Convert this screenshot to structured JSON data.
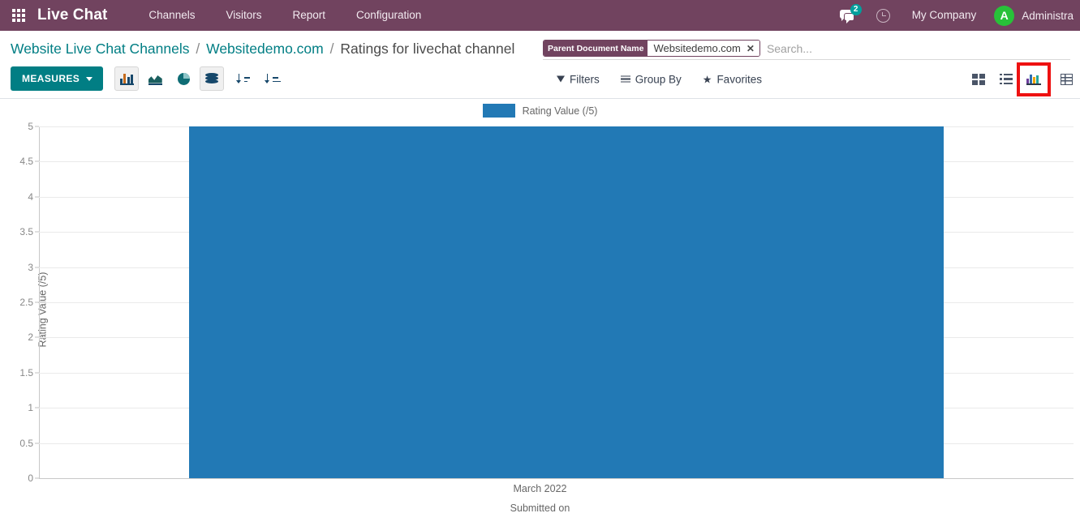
{
  "navbar": {
    "apps_icon": "grid-apps-icon",
    "brand": "Live Chat",
    "menu": [
      {
        "label": "Channels"
      },
      {
        "label": "Visitors"
      },
      {
        "label": "Report"
      },
      {
        "label": "Configuration"
      }
    ],
    "messages_icon": "messages-icon",
    "messages_badge": "2",
    "activity_icon": "clock-icon",
    "company": "My Company",
    "avatar_initial": "A",
    "username": "Administra",
    "background_color": "#71435f"
  },
  "breadcrumb": {
    "root": "Website Live Chat Channels",
    "parent": "Websitedemo.com",
    "current": "Ratings for livechat channel",
    "separator": "/"
  },
  "search": {
    "facet_label": "Parent Document Name",
    "facet_value": "Websitedemo.com",
    "facet_remove_icon": "close-icon",
    "placeholder": "Search...",
    "value": ""
  },
  "toolbar": {
    "measures_label": "MEASURES",
    "measures_color": "#017e84",
    "buttons": [
      {
        "name": "bar-chart",
        "icon": "bar-chart-icon",
        "active": true
      },
      {
        "name": "line-chart",
        "icon": "line-chart-icon",
        "active": false
      },
      {
        "name": "pie-chart",
        "icon": "pie-chart-icon",
        "active": false
      },
      {
        "name": "stacked",
        "icon": "database-stack-icon",
        "active": true
      },
      {
        "name": "sort-descending",
        "icon": "sort-descending-icon",
        "active": false
      },
      {
        "name": "sort-ascending",
        "icon": "sort-ascending-icon",
        "active": false
      }
    ]
  },
  "filter_menus": [
    {
      "label": "Filters",
      "icon": "funnel-icon"
    },
    {
      "label": "Group By",
      "icon": "bars-icon"
    },
    {
      "label": "Favorites",
      "icon": "star-icon"
    }
  ],
  "view_switcher": [
    {
      "name": "kanban-view",
      "icon": "kanban-icon",
      "active": false,
      "annotated": false
    },
    {
      "name": "list-view",
      "icon": "list-icon",
      "active": false,
      "annotated": false
    },
    {
      "name": "graph-view",
      "icon": "graph-icon",
      "active": true,
      "annotated": true
    },
    {
      "name": "pivot-view",
      "icon": "pivot-icon",
      "active": false,
      "annotated": false
    }
  ],
  "annotation": {
    "highlight_color": "#ee1111",
    "target": "graph-view"
  },
  "chart_data": {
    "type": "bar",
    "title": "",
    "legend": [
      {
        "name": "Rating Value (/5)",
        "color": "#2279b5"
      }
    ],
    "legend_position": "top-center",
    "categories": [
      "March 2022"
    ],
    "series": [
      {
        "name": "Rating Value (/5)",
        "values": [
          5
        ],
        "color": "#2279b5"
      }
    ],
    "xlabel": "Submitted on",
    "ylabel": "Rating Value (/5)",
    "ylim": [
      0,
      5
    ],
    "yticks": [
      "0",
      "0.5",
      "1",
      "1.5",
      "2",
      "2.5",
      "3",
      "3.5",
      "4",
      "4.5",
      "5"
    ],
    "ytick_values": [
      0,
      0.5,
      1,
      1.5,
      2,
      2.5,
      3,
      3.5,
      4,
      4.5,
      5
    ],
    "grid": true
  }
}
